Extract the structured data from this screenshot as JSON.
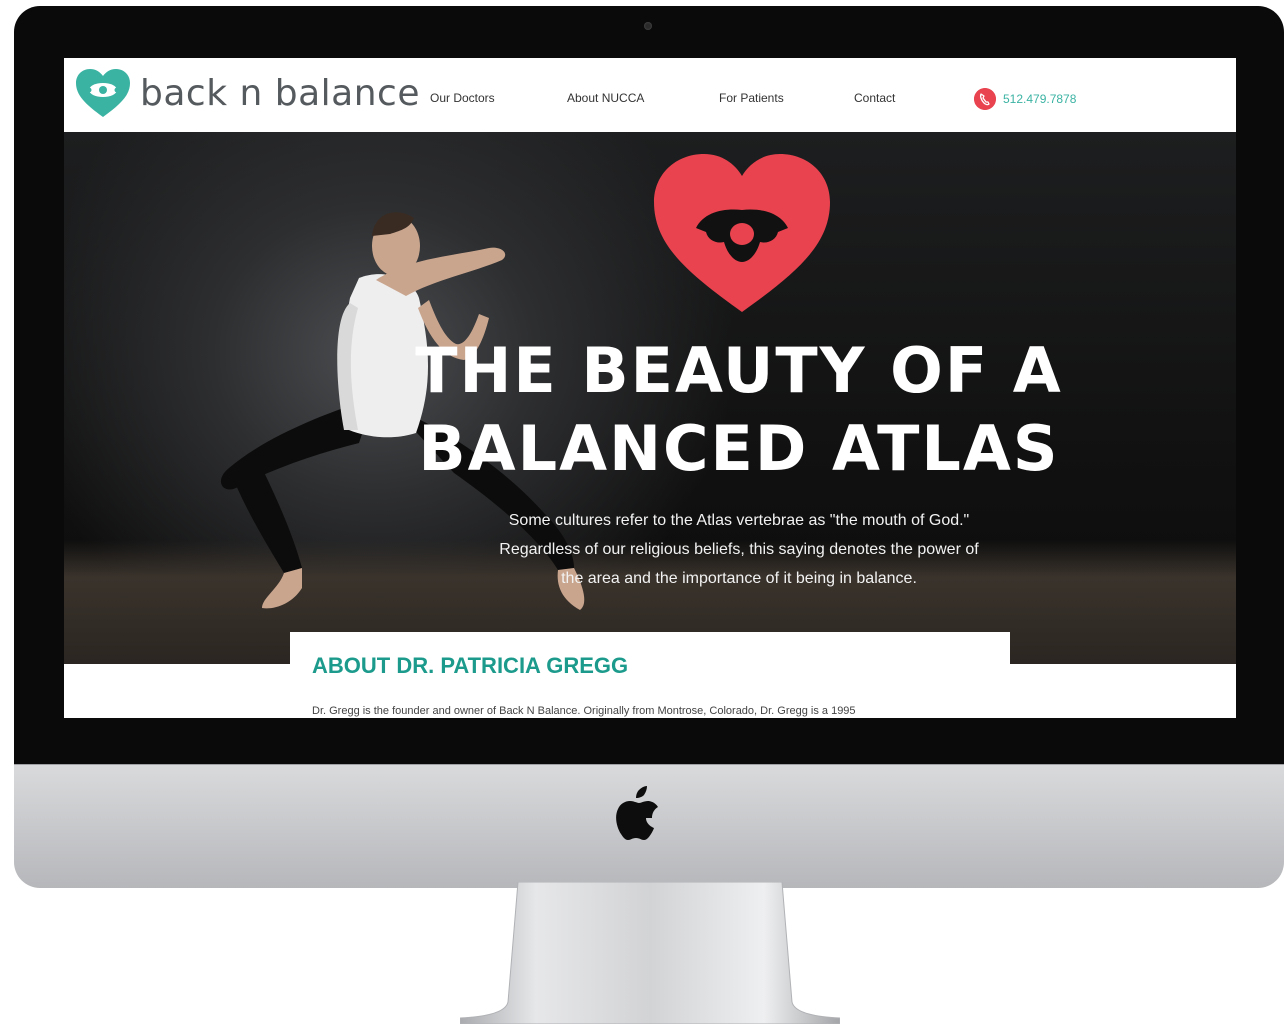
{
  "header": {
    "brand_name": "back n balance",
    "nav": [
      {
        "label": "Our Doctors"
      },
      {
        "label": "About NUCCA"
      },
      {
        "label": "For Patients"
      },
      {
        "label": "Contact"
      }
    ],
    "phone": "512.479.7878"
  },
  "hero": {
    "title_line1": "THE BEAUTY OF A",
    "title_line2": "BALANCED ATLAS",
    "subtitle_line1": "Some cultures refer to the Atlas vertebrae as \"the mouth of God.\"",
    "subtitle_line2": "Regardless of our religious beliefs, this saying denotes the power of",
    "subtitle_line3": "the area and the importance of it being in balance."
  },
  "about": {
    "heading": "ABOUT DR. PATRICIA GREGG",
    "text": "Dr. Gregg is the founder and owner of Back N Balance. Originally from Montrose, Colorado, Dr. Gregg is a 1995"
  },
  "colors": {
    "brand_teal": "#3bb3a3",
    "heading_teal": "#1c9b8c",
    "heart_red": "#e8434f",
    "text_gray": "#555a5e"
  },
  "icons": {
    "logo": "heart-atlas-icon",
    "phone": "phone-icon",
    "hero": "heart-atlas-icon",
    "device": "apple-logo-icon"
  }
}
